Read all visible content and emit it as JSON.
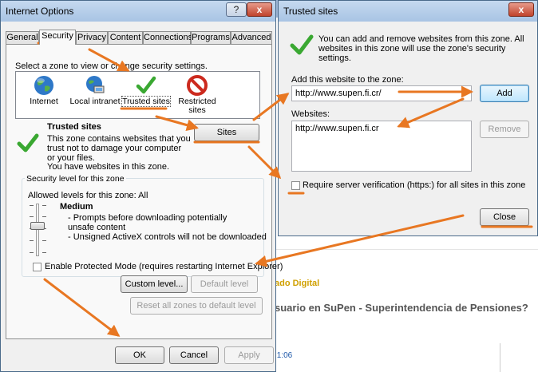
{
  "background": {
    "link_text": "ado Digital",
    "headline": "suario en SuPen - Superintendencia de Pensiones?",
    "time": ":1:06"
  },
  "internet_options": {
    "title": "Internet Options",
    "help_button": "?",
    "close_button": "x",
    "tabs": [
      "General",
      "Security",
      "Privacy",
      "Content",
      "Connections",
      "Programs",
      "Advanced"
    ],
    "active_tab": "Security",
    "zone_prompt": "Select a zone to view or change security settings.",
    "zones": [
      {
        "label": "Internet",
        "icon": "globe-icon"
      },
      {
        "label": "Local intranet",
        "icon": "computer-globe-icon"
      },
      {
        "label": "Trusted sites",
        "icon": "checkmark-icon"
      },
      {
        "label": "Restricted sites",
        "icon": "no-entry-icon"
      }
    ],
    "selected_zone": "Trusted sites",
    "zone_heading": "Trusted sites",
    "zone_description": "This zone contains websites that you trust not to damage your computer or your files.",
    "zone_has_sites": "You have websites in this zone.",
    "sites_button": "Sites",
    "security_group_title": "Security level for this zone",
    "allowed_levels": "Allowed levels for this zone: All",
    "level_name": "Medium",
    "level_items": [
      "- Prompts before downloading potentially unsafe content",
      "- Unsigned ActiveX controls will not be downloaded"
    ],
    "slider_level": 0.4,
    "protected_mode_label": "Enable Protected Mode (requires restarting Internet Explorer)",
    "protected_mode_checked": false,
    "custom_level_button": "Custom level...",
    "default_level_button": "Default level",
    "reset_all_button": "Reset all zones to default level",
    "ok_button": "OK",
    "cancel_button": "Cancel",
    "apply_button": "Apply"
  },
  "trusted_sites": {
    "title": "Trusted sites",
    "close_button": "x",
    "info_text": "You can add and remove websites from this zone. All websites in this zone will use the zone's security settings.",
    "add_label": "Add this website to the zone:",
    "add_value": "http://www.supen.fi.cr/",
    "add_button": "Add",
    "websites_label": "Websites:",
    "websites": [
      "http://www.supen.fi.cr"
    ],
    "remove_button": "Remove",
    "require_https_label": "Require server verification (https:) for all sites in this zone",
    "require_https_checked": false,
    "close_dialog_button": "Close"
  },
  "colors": {
    "annotation": "#e87722",
    "check_green": "#3aa832",
    "restricted_red": "#cc2a1e",
    "globe_blue": "#2e78c8"
  }
}
